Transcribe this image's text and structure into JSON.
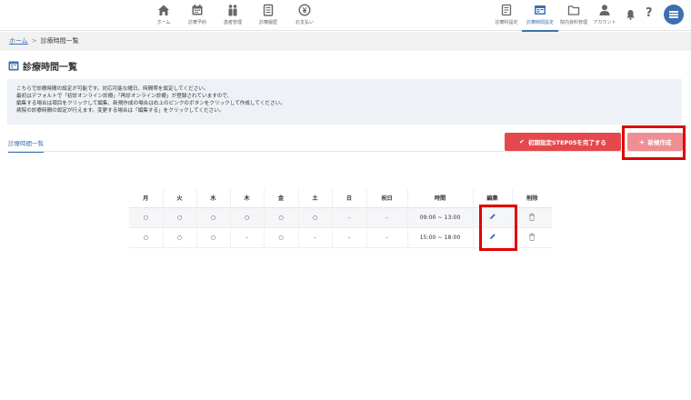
{
  "nav": {
    "items": [
      {
        "label": "ホーム",
        "icon": "home-icon"
      },
      {
        "label": "診療予約",
        "icon": "calendar-icon"
      },
      {
        "label": "患者管理",
        "icon": "patients-icon"
      },
      {
        "label": "診療履歴",
        "icon": "history-icon"
      },
      {
        "label": "お支払い",
        "icon": "payment-icon"
      }
    ],
    "right_items": [
      {
        "label": "診療科設定",
        "icon": "department-icon"
      },
      {
        "label": "診療時間設定",
        "icon": "schedule-icon",
        "active": true
      },
      {
        "label": "院内資料管理",
        "icon": "folder-icon"
      },
      {
        "label": "アカウント",
        "icon": "account-icon"
      }
    ],
    "bell_icon": "bell-icon",
    "help_icon": "help-icon",
    "menu_icon": "menu-icon"
  },
  "breadcrumb": {
    "home": "ホーム",
    "separator": ">",
    "current": "診療時間一覧"
  },
  "page_title": "診療時間一覧",
  "info": {
    "lines": [
      "こちらで診療時間の設定が可能です。対応可能な曜日、時間帯を設定してください。",
      "最初はデフォルトで「初診オンライン診療」「再診オンライン診療」が登録されていますので、",
      "編集する場合は項目をクリックして編集、新規作成の場合は右上のピンクのボタンをクリックして作成してください。",
      "病院の診療時間の設定が行えます。変更する場合は「編集する」をクリックしてください。"
    ]
  },
  "tab_label": "診療時間一覧",
  "buttons": {
    "step_complete": "初期設定STEP05を完了する",
    "new": "新規作成"
  },
  "table": {
    "headers": [
      "月",
      "火",
      "水",
      "木",
      "金",
      "土",
      "日",
      "祝日",
      "時間",
      "編集",
      "削除"
    ],
    "rows": [
      [
        "○",
        "○",
        "○",
        "○",
        "○",
        "○",
        "-",
        "-",
        "09:00 ~ 13:00"
      ],
      [
        "○",
        "○",
        "○",
        "-",
        "○",
        "-",
        "-",
        "-",
        "15:00 ~ 18:00"
      ]
    ]
  },
  "colors": {
    "accent": "#3d6fb0",
    "danger": "#e5484d",
    "new_button": "#ef8f94",
    "highlight": "#e00000"
  }
}
